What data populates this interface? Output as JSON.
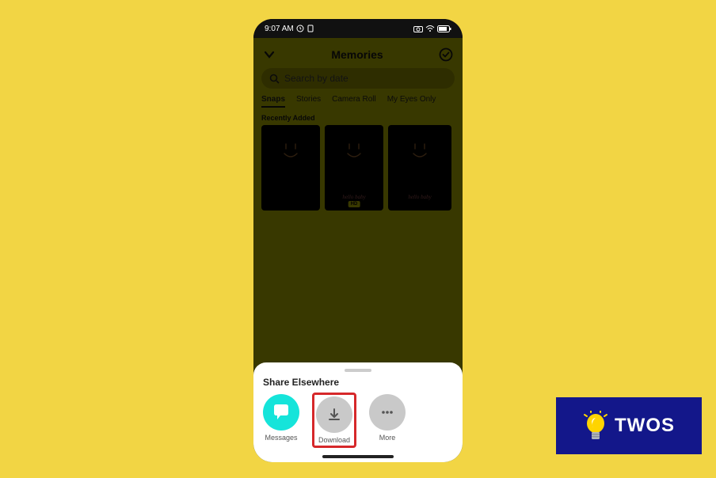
{
  "status": {
    "time": "9:07 AM",
    "icons_left": [
      "clock-icon",
      "note-icon"
    ],
    "icons_right": [
      "camera-icon",
      "wifi-icon",
      "battery-icon"
    ]
  },
  "header": {
    "title": "Memories"
  },
  "search": {
    "placeholder": "Search by date"
  },
  "tabs": [
    {
      "label": "Snaps",
      "active": true
    },
    {
      "label": "Stories",
      "active": false
    },
    {
      "label": "Camera Roll",
      "active": false
    },
    {
      "label": "My Eyes Only",
      "active": false
    }
  ],
  "section_label": "Recently Added",
  "thumbs": [
    {
      "scribble": "",
      "badge": ""
    },
    {
      "scribble": "hello\nbaby",
      "badge": "HD"
    },
    {
      "scribble": "hello\nbaby",
      "badge": ""
    }
  ],
  "share": {
    "title": "Share Elsewhere",
    "items": [
      {
        "key": "messages",
        "label": "Messages"
      },
      {
        "key": "download",
        "label": "Download"
      },
      {
        "key": "more",
        "label": "More"
      }
    ]
  },
  "logo": {
    "text": "TWOS"
  }
}
